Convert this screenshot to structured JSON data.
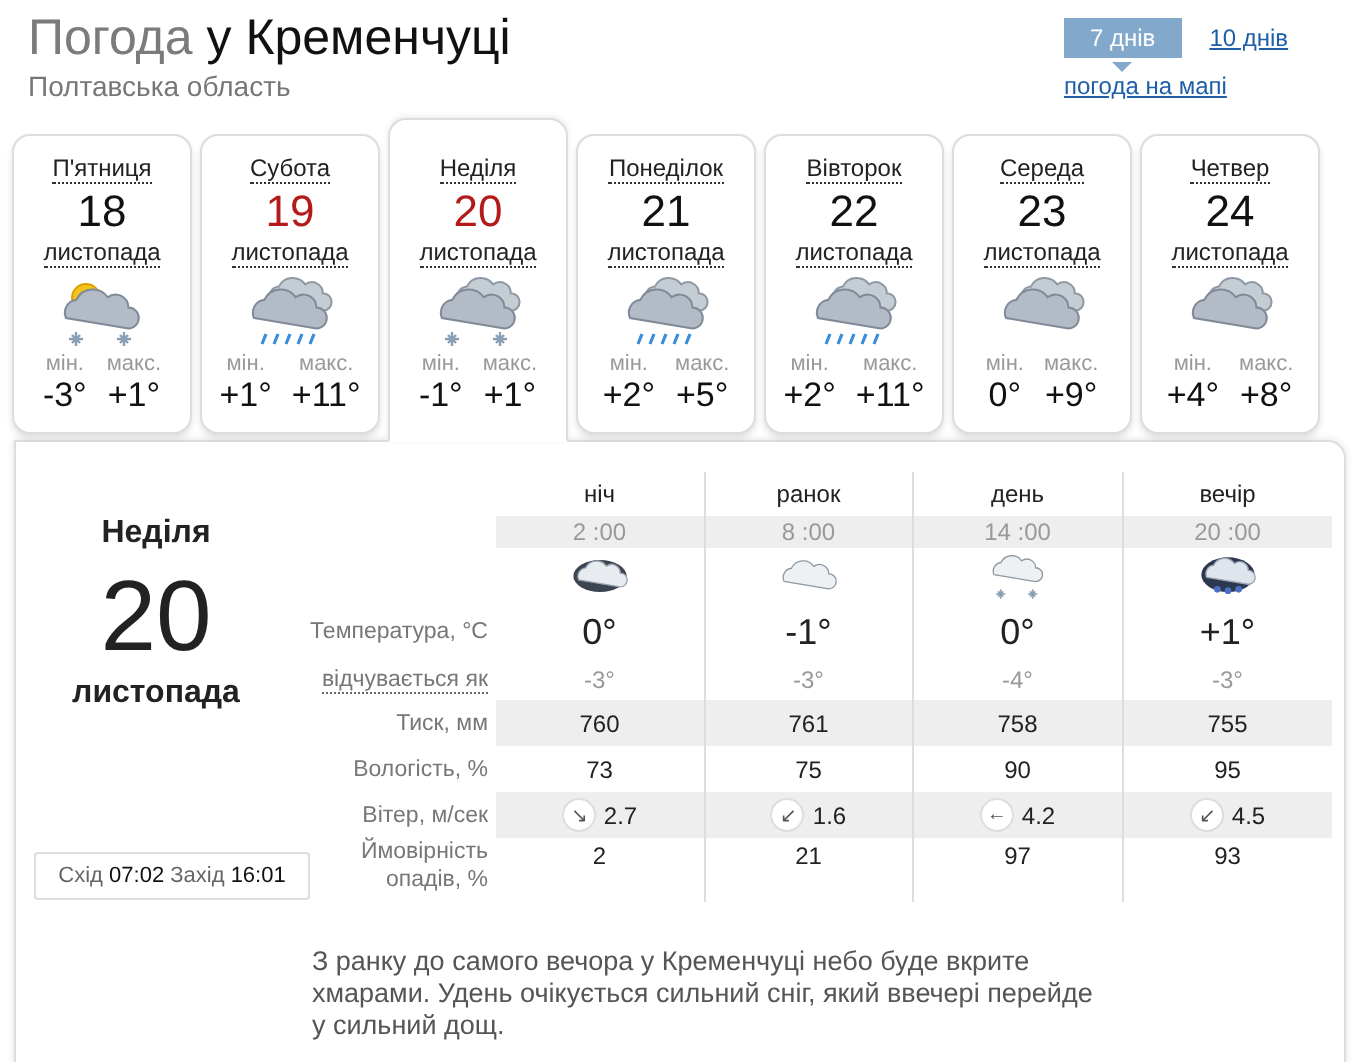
{
  "header": {
    "title_prefix": "Погода",
    "title_place": "у Кременчуці",
    "region": "Полтавська область",
    "range_tabs": [
      {
        "label": "7 днів",
        "selected": true
      },
      {
        "label": "10 днів",
        "selected": false
      }
    ],
    "map_link": "погода на мапі"
  },
  "days": [
    {
      "weekday": "П'ятниця",
      "date": "18",
      "month": "листопада",
      "weekend": false,
      "selected": false,
      "kind": "sun-cloud-snow",
      "min_label": "мін.",
      "min": "-3°",
      "max_label": "макс.",
      "max": "+1°"
    },
    {
      "weekday": "Субота",
      "date": "19",
      "month": "листопада",
      "weekend": true,
      "selected": false,
      "kind": "rain",
      "min_label": "мін.",
      "min": "+1°",
      "max_label": "макс.",
      "max": "+11°"
    },
    {
      "weekday": "Неділя",
      "date": "20",
      "month": "листопада",
      "weekend": true,
      "selected": true,
      "kind": "snow",
      "min_label": "мін.",
      "min": "-1°",
      "max_label": "макс.",
      "max": "+1°"
    },
    {
      "weekday": "Понеділок",
      "date": "21",
      "month": "листопада",
      "weekend": false,
      "selected": false,
      "kind": "rain",
      "min_label": "мін.",
      "min": "+2°",
      "max_label": "макс.",
      "max": "+5°"
    },
    {
      "weekday": "Вівторок",
      "date": "22",
      "month": "листопада",
      "weekend": false,
      "selected": false,
      "kind": "rain",
      "min_label": "мін.",
      "min": "+2°",
      "max_label": "макс.",
      "max": "+11°"
    },
    {
      "weekday": "Середа",
      "date": "23",
      "month": "листопада",
      "weekend": false,
      "selected": false,
      "kind": "cloud",
      "min_label": "мін.",
      "min": "0°",
      "max_label": "макс.",
      "max": "+9°"
    },
    {
      "weekday": "Четвер",
      "date": "24",
      "month": "листопада",
      "weekend": false,
      "selected": false,
      "kind": "cloud",
      "min_label": "мін.",
      "min": "+4°",
      "max_label": "макс.",
      "max": "+8°"
    }
  ],
  "detail": {
    "weekday": "Неділя",
    "date": "20",
    "month": "листопада",
    "sun": "Схід **07:02** Захід **16:01**",
    "labels": {
      "temp": "Температура, °С",
      "feels": "відчувається як",
      "pressure": "Тиск, мм",
      "humidity": "Вологість, %",
      "wind": "Вітер, м/сек",
      "precip": "Ймовірність опадів, %"
    },
    "periods": [
      {
        "name": "ніч",
        "time": "2 :00",
        "kind": "dark-cloud",
        "temp": "0°",
        "feels": "-3°",
        "pressure": "760",
        "humidity": "73",
        "wind_arrow": "↘",
        "wind": "2.7",
        "precip": "2"
      },
      {
        "name": "ранок",
        "time": "8 :00",
        "kind": "light-cloud",
        "temp": "-1°",
        "feels": "-3°",
        "pressure": "761",
        "humidity": "75",
        "wind_arrow": "↙",
        "wind": "1.6",
        "precip": "21"
      },
      {
        "name": "день",
        "time": "14 :00",
        "kind": "light-snow",
        "temp": "0°",
        "feels": "-4°",
        "pressure": "758",
        "humidity": "90",
        "wind_arrow": "←",
        "wind": "4.2",
        "precip": "97"
      },
      {
        "name": "вечір",
        "time": "20 :00",
        "kind": "dark-rain",
        "temp": "+1°",
        "feels": "-3°",
        "pressure": "755",
        "humidity": "95",
        "wind_arrow": "↙",
        "wind": "4.5",
        "precip": "93"
      }
    ],
    "description": "З ранку до самого вечора у Кременчуці небо буде вкрите хмарами. Удень очікується сильний сніг, який ввечері перейде у сильний дощ."
  }
}
